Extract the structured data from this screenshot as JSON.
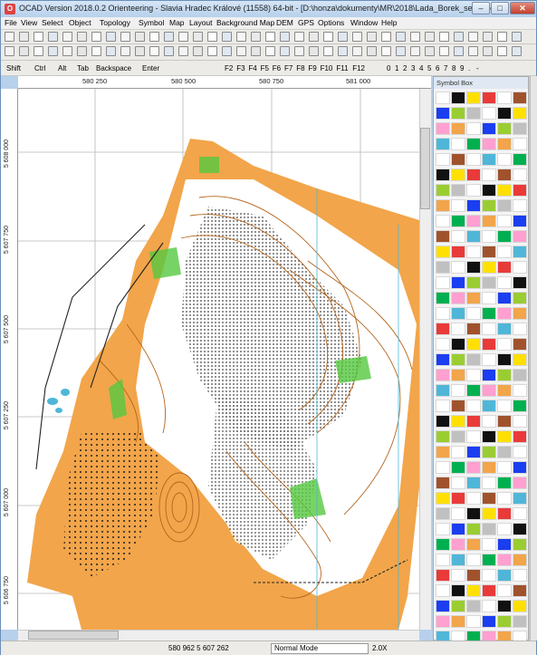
{
  "window": {
    "title": "OCAD Version 2018.0.2  Orienteering - Slavia Hradec Králové (11558) 64-bit - [D:\\honza\\dokumenty\\MR\\2018\\Lada_Borek_sever.ocd]",
    "app_icon_glyph": "O",
    "min_label": "–",
    "max_label": "□",
    "close_label": "✕"
  },
  "menu": [
    "File",
    "View",
    "Select",
    "Object",
    "Topology",
    "Symbol",
    "Map",
    "Layout",
    "Background Map",
    "DEM",
    "GPS",
    "Options",
    "Window",
    "Help"
  ],
  "keys_toolbar": {
    "modifiers": [
      "Shift",
      "Ctrl",
      "Alt",
      "Tab",
      "Backspace",
      "Enter"
    ],
    "fkeys": [
      "F2",
      "F3",
      "F4",
      "F5",
      "F6",
      "F7",
      "F8",
      "F9",
      "F10",
      "F11",
      "F12"
    ],
    "digits": [
      "0",
      "1",
      "2",
      "3",
      "4",
      "5",
      "6",
      "7",
      "8",
      "9",
      ".",
      "-"
    ]
  },
  "ruler": {
    "x_labels": [
      "580 250",
      "580 500",
      "580 750",
      "581 000"
    ],
    "y_labels": [
      "5 608 000",
      "5 607 750",
      "5 607 500",
      "5 607 250",
      "5 607 000",
      "5 606 750"
    ]
  },
  "symbol_box": {
    "title": "Symbol Box"
  },
  "status": {
    "coords": "580 962    5 607 262",
    "mode": "Normal Mode",
    "zoom": "2.0X"
  },
  "colors": {
    "map_orange": "#f2a54a",
    "map_white": "#ffffff",
    "contour_brown": "#b5651d",
    "green": "#55c840",
    "water_blue": "#4fb6d8",
    "black": "#111111"
  }
}
